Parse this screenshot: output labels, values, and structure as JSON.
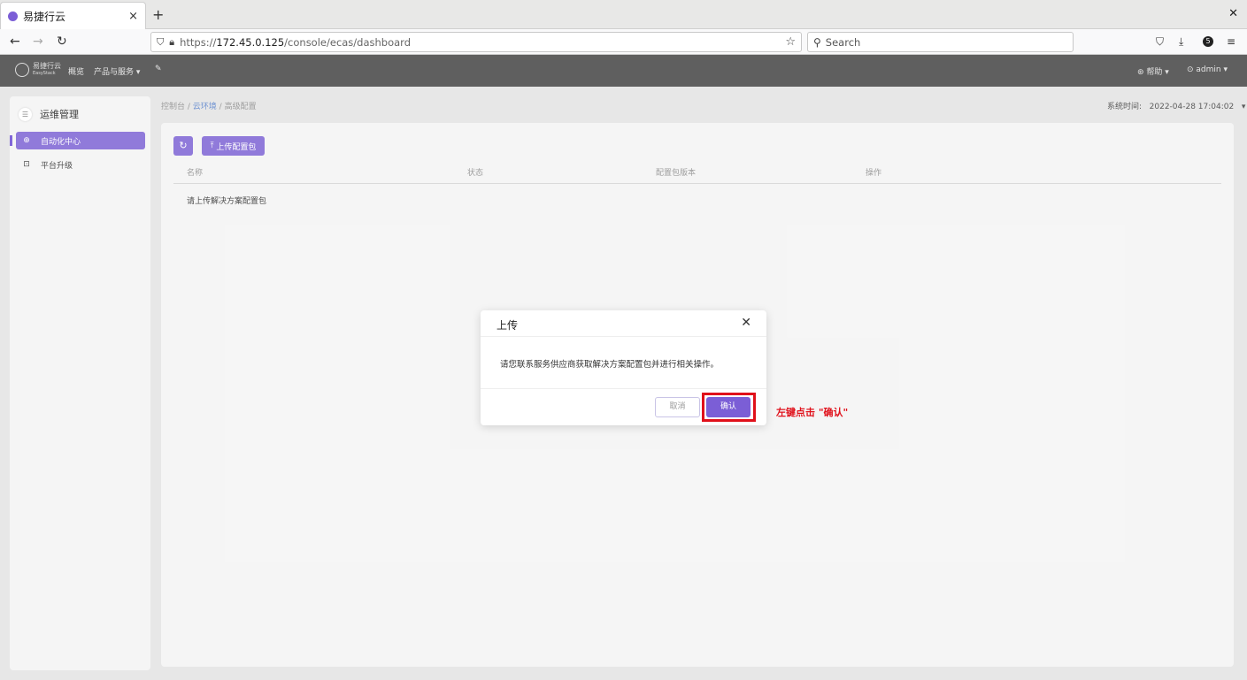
{
  "browser": {
    "tab_title": "易捷行云",
    "new_tab_icon": "+",
    "close_icon": "×",
    "window_close": "✕",
    "url_prefix": "https://",
    "url_host": "172.45.0.125",
    "url_path": "/console/ecas/dashboard",
    "search_placeholder": "Search",
    "extension_badge": "5"
  },
  "header": {
    "logo_name": "易捷行云",
    "logo_sub": "EasyStack",
    "nav_overview": "概览",
    "nav_products": "产品与服务 ▾",
    "help": "帮助 ▾",
    "user": "admin ▾"
  },
  "sidebar": {
    "title": "运维管理",
    "items": [
      {
        "label": "自动化中心",
        "icon": "automation-icon"
      },
      {
        "label": "平台升级",
        "icon": "upgrade-icon"
      }
    ]
  },
  "breadcrumb": {
    "root": "控制台 /",
    "cloud_env": "云环境",
    "sep": "/",
    "current": "高级配置"
  },
  "system_time": {
    "label": "系统时间:",
    "value": "2022-04-28 17:04:02"
  },
  "toolbar": {
    "upload_label": "上传配置包"
  },
  "table": {
    "columns": [
      "名称",
      "状态",
      "配置包版本",
      "操作"
    ],
    "empty_text": "请上传解决方案配置包"
  },
  "dialog": {
    "title": "上传",
    "body": "请您联系服务供应商获取解决方案配置包并进行相关操作。",
    "cancel_label": "取消",
    "confirm_label": "确认"
  },
  "annotation": {
    "text": "左键点击 \"确认\"",
    "color": "#e0101a"
  },
  "colors": {
    "accent": "#7b5ed6",
    "header_bg": "#5f5f5f"
  }
}
